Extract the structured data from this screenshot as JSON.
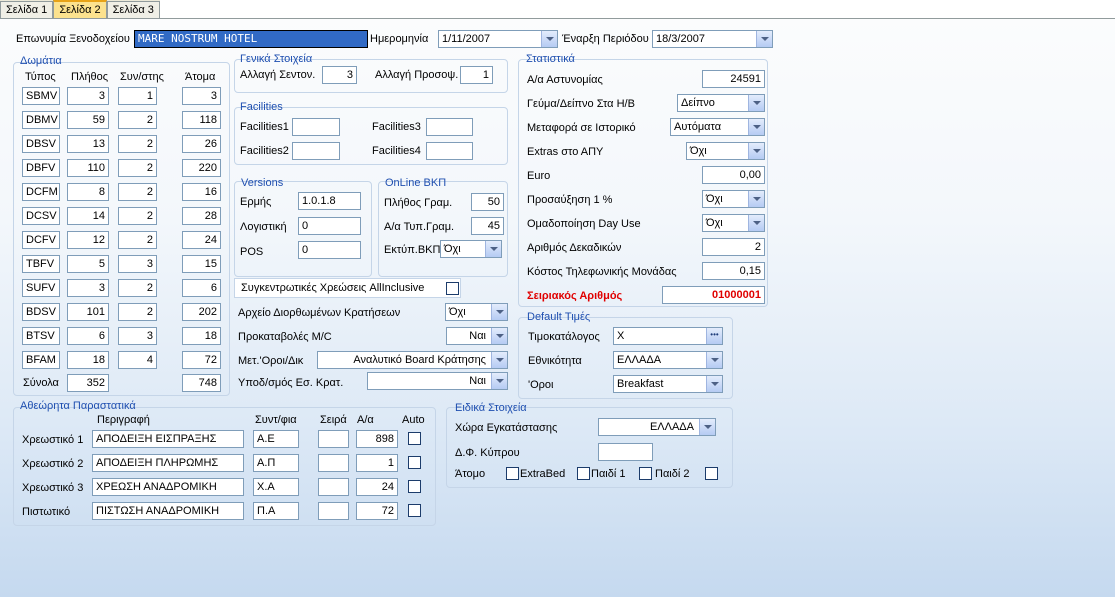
{
  "tabs": [
    "Σελίδα 1",
    "Σελίδα 2",
    "Σελίδα 3"
  ],
  "header": {
    "hotel_label": "Επωνυμία Ξενοδοχείου",
    "hotel_value": "MARE NOSTRUM HOTEL",
    "date_label": "Ημερομηνία",
    "date_value": "1/11/2007",
    "period_label": "Έναρξη Περιόδου",
    "period_value": "18/3/2007"
  },
  "rooms": {
    "title": "Δωμάτια",
    "col_type": "Τύπος",
    "col_count": "Πλήθος",
    "col_coef": "Συν/στης",
    "col_persons": "Άτομα",
    "rows": [
      {
        "type": "SBMV",
        "count": "3",
        "coef": "1",
        "persons": "3"
      },
      {
        "type": "DBMV",
        "count": "59",
        "coef": "2",
        "persons": "118"
      },
      {
        "type": "DBSV",
        "count": "13",
        "coef": "2",
        "persons": "26"
      },
      {
        "type": "DBFV",
        "count": "110",
        "coef": "2",
        "persons": "220"
      },
      {
        "type": "DCFM",
        "count": "8",
        "coef": "2",
        "persons": "16"
      },
      {
        "type": "DCSV",
        "count": "14",
        "coef": "2",
        "persons": "28"
      },
      {
        "type": "DCFV",
        "count": "12",
        "coef": "2",
        "persons": "24"
      },
      {
        "type": "TBFV",
        "count": "5",
        "coef": "3",
        "persons": "15"
      },
      {
        "type": "SUFV",
        "count": "3",
        "coef": "2",
        "persons": "6"
      },
      {
        "type": "BDSV",
        "count": "101",
        "coef": "2",
        "persons": "202"
      },
      {
        "type": "BTSV",
        "count": "6",
        "coef": "3",
        "persons": "18"
      },
      {
        "type": "BFAM",
        "count": "18",
        "coef": "4",
        "persons": "72"
      }
    ],
    "totals_label": "Σύνολα",
    "total_count": "352",
    "total_persons": "748"
  },
  "general": {
    "title": "Γενικά Στοιχεία",
    "sheets_label": "Αλλαγή Σεντον.",
    "sheets_value": "3",
    "towels_label": "Αλλαγή Προσοψ.",
    "towels_value": "1"
  },
  "facilities": {
    "title": "Facilities",
    "f1": "Facilities1",
    "f2": "Facilities2",
    "f3": "Facilities3",
    "f4": "Facilities4"
  },
  "versions": {
    "title": "Versions",
    "hermes_label": "Ερμής",
    "hermes_value": "1.0.1.8",
    "logistiki_label": "Λογιστική",
    "logistiki_value": "0",
    "pos_label": "POS",
    "pos_value": "0"
  },
  "online": {
    "title": "OnLine ΒΚΠ",
    "lines_label": "Πλήθος Γραμ.",
    "lines_value": "50",
    "tline_label": "Α/α Τυπ.Γραμ.",
    "tline_value": "45",
    "print_label": "Εκτύπ.ΒΚΠ",
    "print_value": "Όχι"
  },
  "options": {
    "allinclusive_label": "Συγκεντρωτικές Χρεώσεις AllInclusive",
    "corrected_label": "Αρχείο Διορθωμένων Κρατήσεων",
    "corrected_value": "Όχι",
    "advances_label": "Προκαταβολές Μ/C",
    "advances_value": "Ναι",
    "transfer_label": "Μετ.'Οροι/Δικ",
    "transfer_value": "Αναλυτικό Board Κράτησης",
    "split_label": "Υποδ/σμός Εσ. Κρατ.",
    "split_value": "Ναι"
  },
  "docs": {
    "title": "Αθεώρητα Παραστατικά",
    "col_desc": "Περιγραφή",
    "col_abbr": "Συντ/φια",
    "col_series": "Σειρά",
    "col_num": "Α/α",
    "col_auto": "Auto",
    "rows": [
      {
        "label": "Χρεωστικό 1",
        "desc": "ΑΠΟΔΕΙΞΗ ΕΙΣΠΡΑΞΗΣ",
        "abbr": "Α.Ε",
        "series": "",
        "num": "898"
      },
      {
        "label": "Χρεωστικό 2",
        "desc": "ΑΠΟΔΕΙΞΗ ΠΛΗΡΩΜΗΣ",
        "abbr": "Α.Π",
        "series": "",
        "num": "1"
      },
      {
        "label": "Χρεωστικό 3",
        "desc": "ΧΡΕΩΣΗ ΑΝΑΔΡΟΜΙΚΗ",
        "abbr": "Χ.Α",
        "series": "",
        "num": "24"
      },
      {
        "label": "Πιστωτικό",
        "desc": "ΠΙΣΤΩΣΗ ΑΝΑΔΡΟΜΙΚΗ",
        "abbr": "Π.Α",
        "series": "",
        "num": "72"
      }
    ]
  },
  "stats": {
    "title": "Στατιστικά",
    "police_label": "Α/α Αστυνομίας",
    "police_value": "24591",
    "meal_label": "Γεύμα/Δείπνο Στα Η/Β",
    "meal_value": "Δείπνο",
    "history_label": "Μεταφορά σε Ιστορικό",
    "history_value": "Αυτόματα",
    "extras_label": "Extras στο ΑΠΥ",
    "extras_value": "Όχι",
    "euro_label": "Euro",
    "euro_value": "0,00",
    "increase_label": "Προσαύξηση 1 %",
    "increase_value": "Όχι",
    "dayuse_label": "Ομαδοποίηση Day Use",
    "dayuse_value": "Όχι",
    "decimals_label": "Αριθμός Δεκαδικών",
    "decimals_value": "2",
    "phone_label": "Κόστος Τηλεφωνικής Μονάδας",
    "phone_value": "0,15",
    "serial_label": "Σειριακός Αριθμός",
    "serial_value": "01000001"
  },
  "defaults": {
    "title": "Default Τιμές",
    "pricelist_label": "Τιμοκατάλογος",
    "pricelist_value": "X",
    "pricelist_btn": "•••",
    "nationality_label": "Εθνικότητα",
    "nationality_value": "ΕΛΛΑΔΑ",
    "terms_label": "'Οροι",
    "terms_value": "Breakfast"
  },
  "special": {
    "title": "Ειδικά Στοιχεία",
    "country_label": "Χώρα Εγκατάστασης",
    "country_value": "ΕΛΛΑΔΑ",
    "cyprus_label": "Δ.Φ. Κύπρου",
    "person_label": "Άτομο",
    "extrabed_label": "ExtraBed",
    "child1_label": "Παιδί 1",
    "child2_label": "Παιδί 2"
  }
}
